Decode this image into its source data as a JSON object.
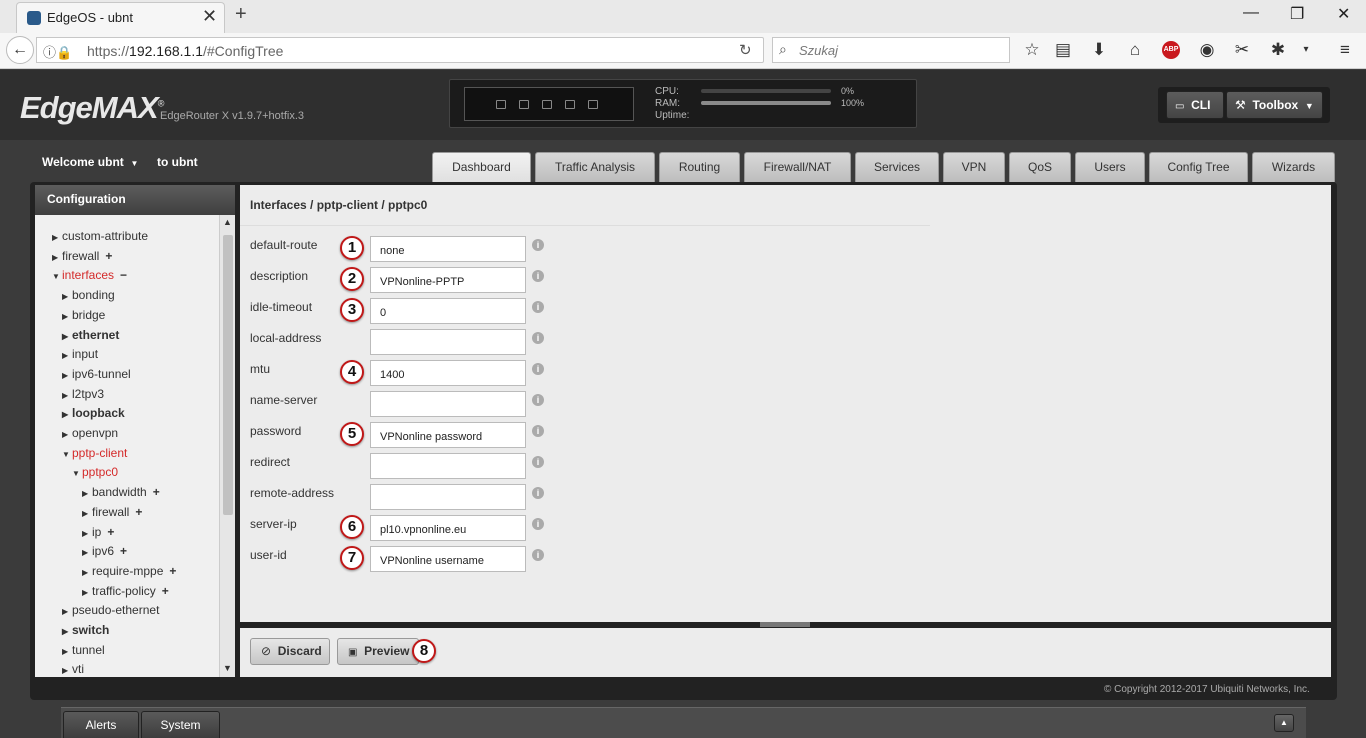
{
  "browser": {
    "tab_title": "EdgeOS - ubnt",
    "url_prefix": "https://",
    "url_host": "192.168.1.1",
    "url_path": "/#ConfigTree",
    "search_placeholder": "Szukaj",
    "abp_label": "ABP"
  },
  "header": {
    "logo": "EdgeMAX",
    "logo_mark": "®",
    "router_version": "EdgeRouter X v1.9.7+hotfix.3",
    "stats": {
      "cpu_label": "CPU:",
      "cpu_value": "0%",
      "cpu_fraction": 0,
      "ram_label": "RAM:",
      "ram_value": "100%",
      "ram_fraction": 1,
      "uptime_label": "Uptime:"
    },
    "cli_label": "CLI",
    "toolbox_label": "Toolbox"
  },
  "user": {
    "welcome": "Welcome ubnt",
    "to_ubnt": "to ubnt"
  },
  "nav_tabs": [
    "Dashboard",
    "Traffic Analysis",
    "Routing",
    "Firewall/NAT",
    "Services",
    "VPN",
    "QoS",
    "Users",
    "Config Tree",
    "Wizards"
  ],
  "active_tab": "Dashboard",
  "sidebar": {
    "title": "Configuration",
    "items": [
      {
        "label": "custom-attribute",
        "level": 0,
        "arrow": "right",
        "style": "normal",
        "action": ""
      },
      {
        "label": "firewall",
        "level": 0,
        "arrow": "right",
        "style": "normal",
        "action": "+"
      },
      {
        "label": "interfaces",
        "level": 0,
        "arrow": "down",
        "style": "red",
        "action": "−"
      },
      {
        "label": "bonding",
        "level": 1,
        "arrow": "right",
        "style": "normal",
        "action": ""
      },
      {
        "label": "bridge",
        "level": 1,
        "arrow": "right",
        "style": "normal",
        "action": ""
      },
      {
        "label": "ethernet",
        "level": 1,
        "arrow": "right",
        "style": "bold",
        "action": ""
      },
      {
        "label": "input",
        "level": 1,
        "arrow": "right",
        "style": "normal",
        "action": ""
      },
      {
        "label": "ipv6-tunnel",
        "level": 1,
        "arrow": "right",
        "style": "normal",
        "action": ""
      },
      {
        "label": "l2tpv3",
        "level": 1,
        "arrow": "right",
        "style": "normal",
        "action": ""
      },
      {
        "label": "loopback",
        "level": 1,
        "arrow": "right",
        "style": "bold",
        "action": ""
      },
      {
        "label": "openvpn",
        "level": 1,
        "arrow": "right",
        "style": "normal",
        "action": ""
      },
      {
        "label": "pptp-client",
        "level": 1,
        "arrow": "down",
        "style": "red",
        "action": ""
      },
      {
        "label": "pptpc0",
        "level": 2,
        "arrow": "down",
        "style": "red",
        "action": ""
      },
      {
        "label": "bandwidth",
        "level": 3,
        "arrow": "right",
        "style": "normal",
        "action": "+"
      },
      {
        "label": "firewall",
        "level": 3,
        "arrow": "right",
        "style": "normal",
        "action": "+"
      },
      {
        "label": "ip",
        "level": 3,
        "arrow": "right",
        "style": "normal",
        "action": "+"
      },
      {
        "label": "ipv6",
        "level": 3,
        "arrow": "right",
        "style": "normal",
        "action": "+"
      },
      {
        "label": "require-mppe",
        "level": 3,
        "arrow": "right",
        "style": "normal",
        "action": "+"
      },
      {
        "label": "traffic-policy",
        "level": 3,
        "arrow": "right",
        "style": "normal",
        "action": "+"
      },
      {
        "label": "pseudo-ethernet",
        "level": 1,
        "arrow": "right",
        "style": "normal",
        "action": ""
      },
      {
        "label": "switch",
        "level": 1,
        "arrow": "right",
        "style": "bold",
        "action": ""
      },
      {
        "label": "tunnel",
        "level": 1,
        "arrow": "right",
        "style": "normal",
        "action": ""
      },
      {
        "label": "vti",
        "level": 1,
        "arrow": "right",
        "style": "normal",
        "action": ""
      }
    ]
  },
  "content": {
    "breadcrumb": "Interfaces / pptp-client / pptpc0",
    "fields": [
      {
        "label": "default-route",
        "value": "none",
        "badge": "1"
      },
      {
        "label": "description",
        "value": "VPNonline-PPTP",
        "badge": "2"
      },
      {
        "label": "idle-timeout",
        "value": "0",
        "badge": "3"
      },
      {
        "label": "local-address",
        "value": "",
        "badge": ""
      },
      {
        "label": "mtu",
        "value": "1400",
        "badge": "4"
      },
      {
        "label": "name-server",
        "value": "",
        "badge": ""
      },
      {
        "label": "password",
        "value": "VPNonline password",
        "badge": "5"
      },
      {
        "label": "redirect",
        "value": "",
        "badge": ""
      },
      {
        "label": "remote-address",
        "value": "",
        "badge": ""
      },
      {
        "label": "server-ip",
        "value": "pl10.vpnonline.eu",
        "badge": "6"
      },
      {
        "label": "user-id",
        "value": "VPNonline username",
        "badge": "7"
      }
    ]
  },
  "actions": {
    "discard_label": "Discard",
    "preview_label": "Preview",
    "preview_badge": "8"
  },
  "footer": {
    "copyright": "© Copyright 2012-2017 Ubiquiti Networks, Inc."
  },
  "bottom_tabs": [
    "Alerts",
    "System"
  ]
}
